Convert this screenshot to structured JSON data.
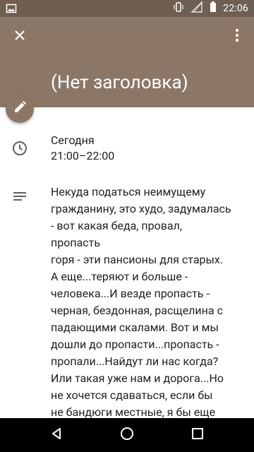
{
  "status_bar": {
    "time": "22:06",
    "icons": [
      "image-icon",
      "vibrate-icon",
      "signal-icon",
      "battery-icon"
    ]
  },
  "header": {
    "title": "(Нет заголовка)",
    "close_icon": "close-icon",
    "more_icon": "more-vertical-icon",
    "color": "#8c7767"
  },
  "event": {
    "date_label": "Сегодня",
    "time_range": "21:00–22:00",
    "description": "Некуда податься неимущему\nгражданину, это худо, задумалась\n- вот какая беда, провал, пропасть\nгоря - эти пансионы для старых.\nА еще...теряют и больше -\nчеловека...И везде пропасть -\nчерная, бездонная, расщелина с\nпадающими скалами. Вот и мы\nдошли до пропасти...пропасть -\nпропали...Найдут ли нас когда?\nИли такая уже нам и дорога...Но\nне хочется сдаваться, если бы\nне бандюги местные, я бы еще\nнормально пожила...А под гнетом\nбандюг вряд ли вообще тут\nвыживешь..."
  },
  "nav": {
    "back_icon": "back-icon",
    "home_icon": "home-icon",
    "recents_icon": "recents-icon"
  }
}
